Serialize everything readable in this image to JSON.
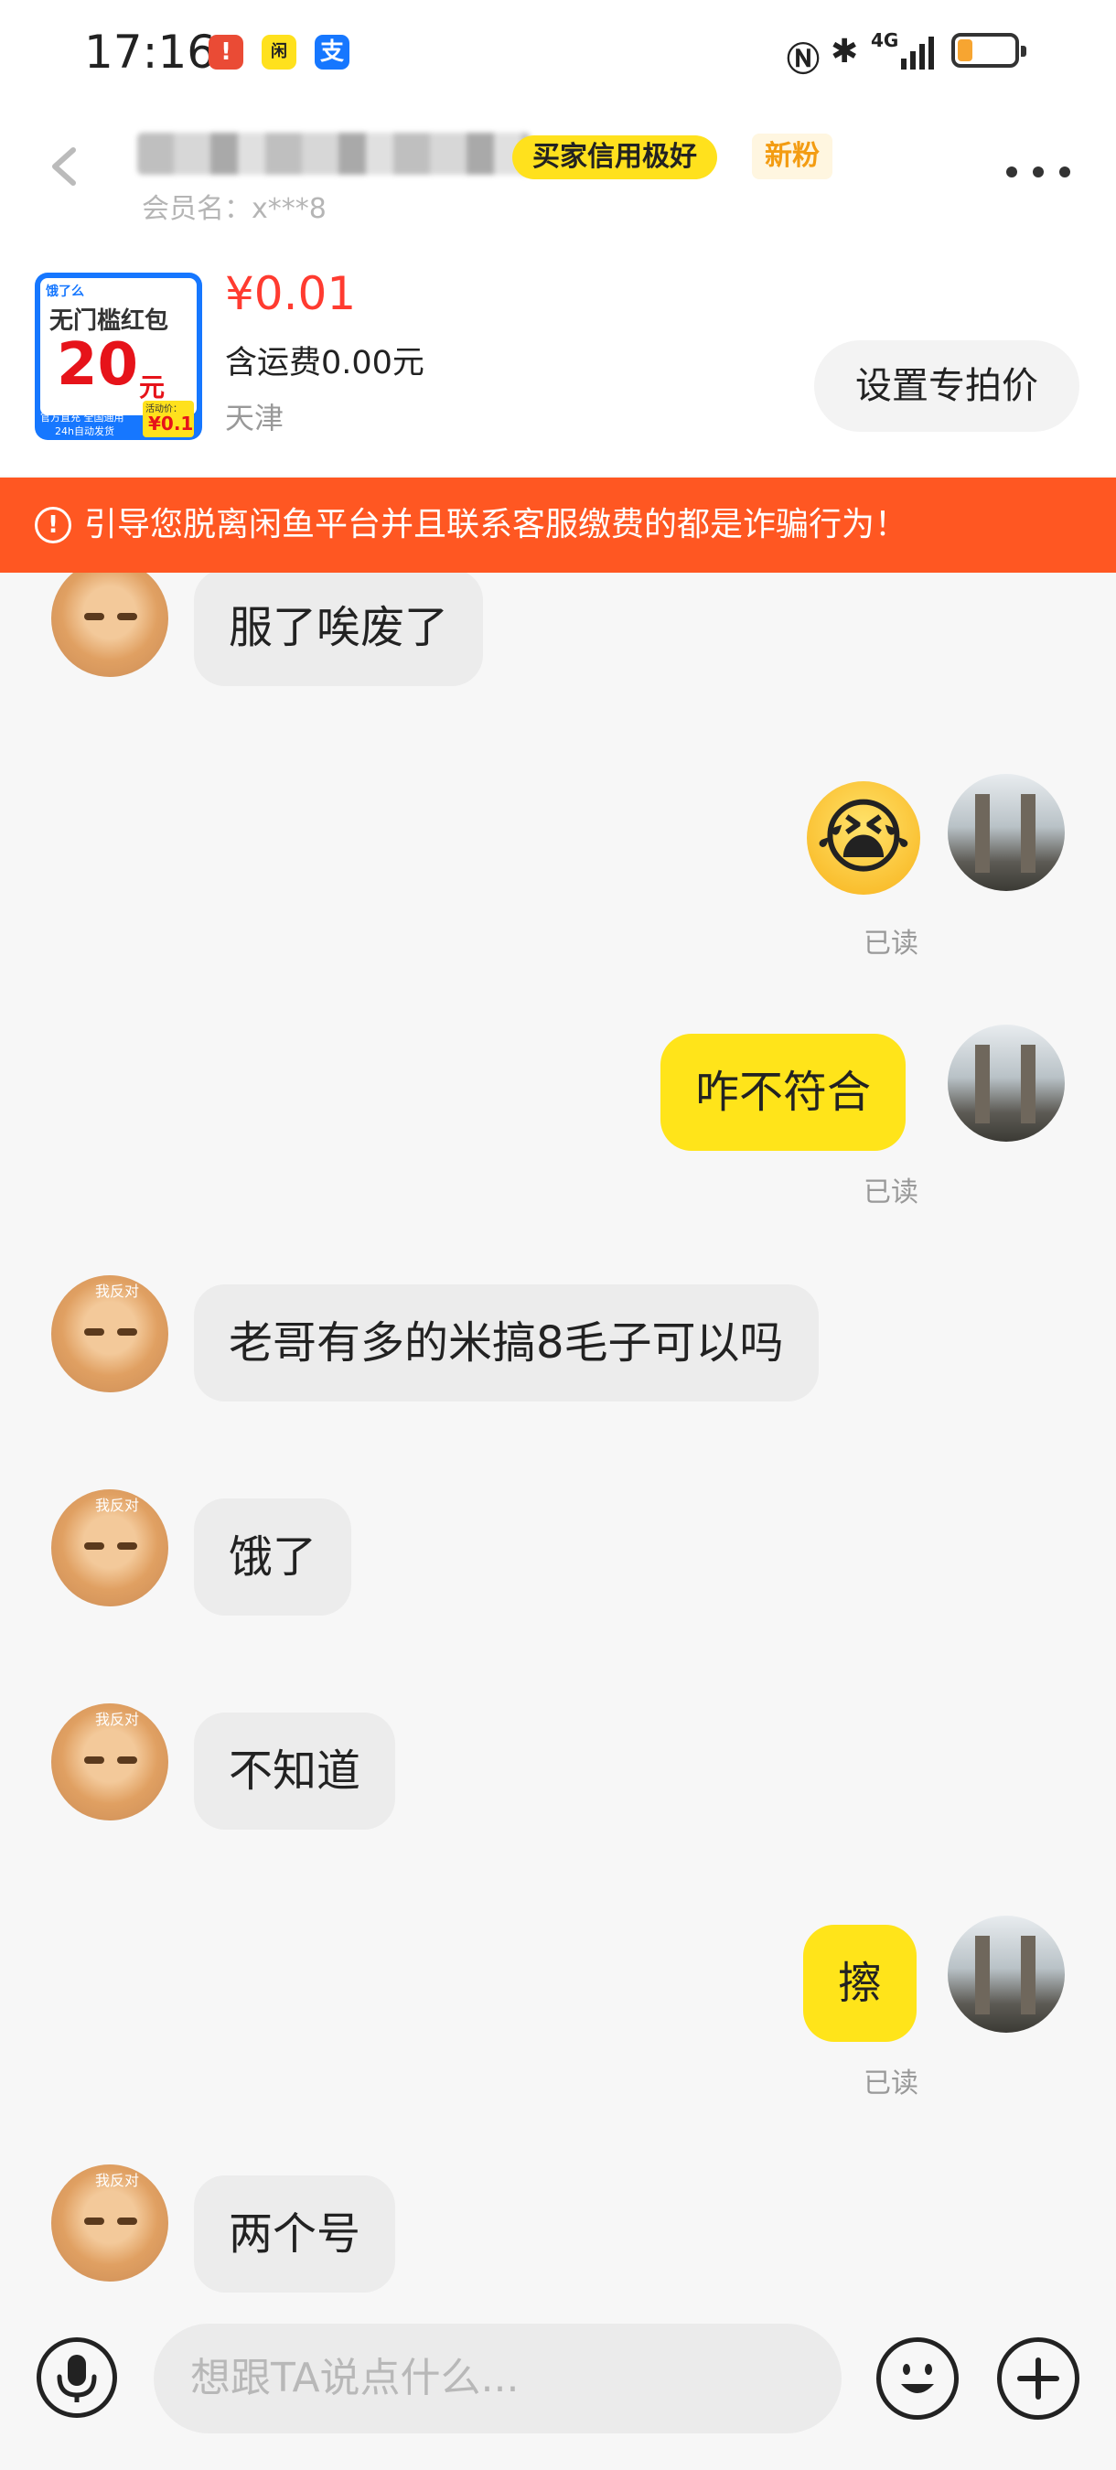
{
  "status_bar": {
    "time": "17:16",
    "network": "4G",
    "app_icons": [
      "notification-red-icon",
      "xianyu-app-icon",
      "alipay-icon"
    ]
  },
  "header": {
    "credit_badge": "买家信用极好",
    "fan_badge": "新粉",
    "member_label": "会员名：x***8"
  },
  "product": {
    "image_title": "无门槛红包",
    "image_amount": "20",
    "image_unit": "元",
    "image_brand": "饿了么",
    "image_note1": "官方直充 全国通用",
    "image_note2": "24h自动发货",
    "image_promo_label": "活动价：",
    "image_promo_price": "¥0.1",
    "price": "¥0.01",
    "shipping": "含运费0.00元",
    "location": "天津",
    "set_price_button": "设置专拍价"
  },
  "warning": {
    "text": "引导您脱离闲鱼平台并且联系客服缴费的都是诈骗行为！"
  },
  "messages": [
    {
      "side": "left",
      "text": "服了唉废了"
    },
    {
      "side": "right",
      "type": "emoji",
      "text": "😭",
      "read": "已读"
    },
    {
      "side": "right",
      "text": "咋不符合",
      "read": "已读"
    },
    {
      "side": "left",
      "text": "老哥有多的米搞8毛子可以吗"
    },
    {
      "side": "left",
      "text": "饿了"
    },
    {
      "side": "left",
      "text": "不知道"
    },
    {
      "side": "right",
      "text": "擦",
      "read": "已读"
    },
    {
      "side": "left",
      "text": "两个号"
    }
  ],
  "avatar_tag": "我反对",
  "input": {
    "placeholder": "想跟TA说点什么..."
  },
  "colors": {
    "accent_yellow": "#ffe41a",
    "warning_orange": "#ff5722",
    "price_red": "#ff3b30"
  }
}
